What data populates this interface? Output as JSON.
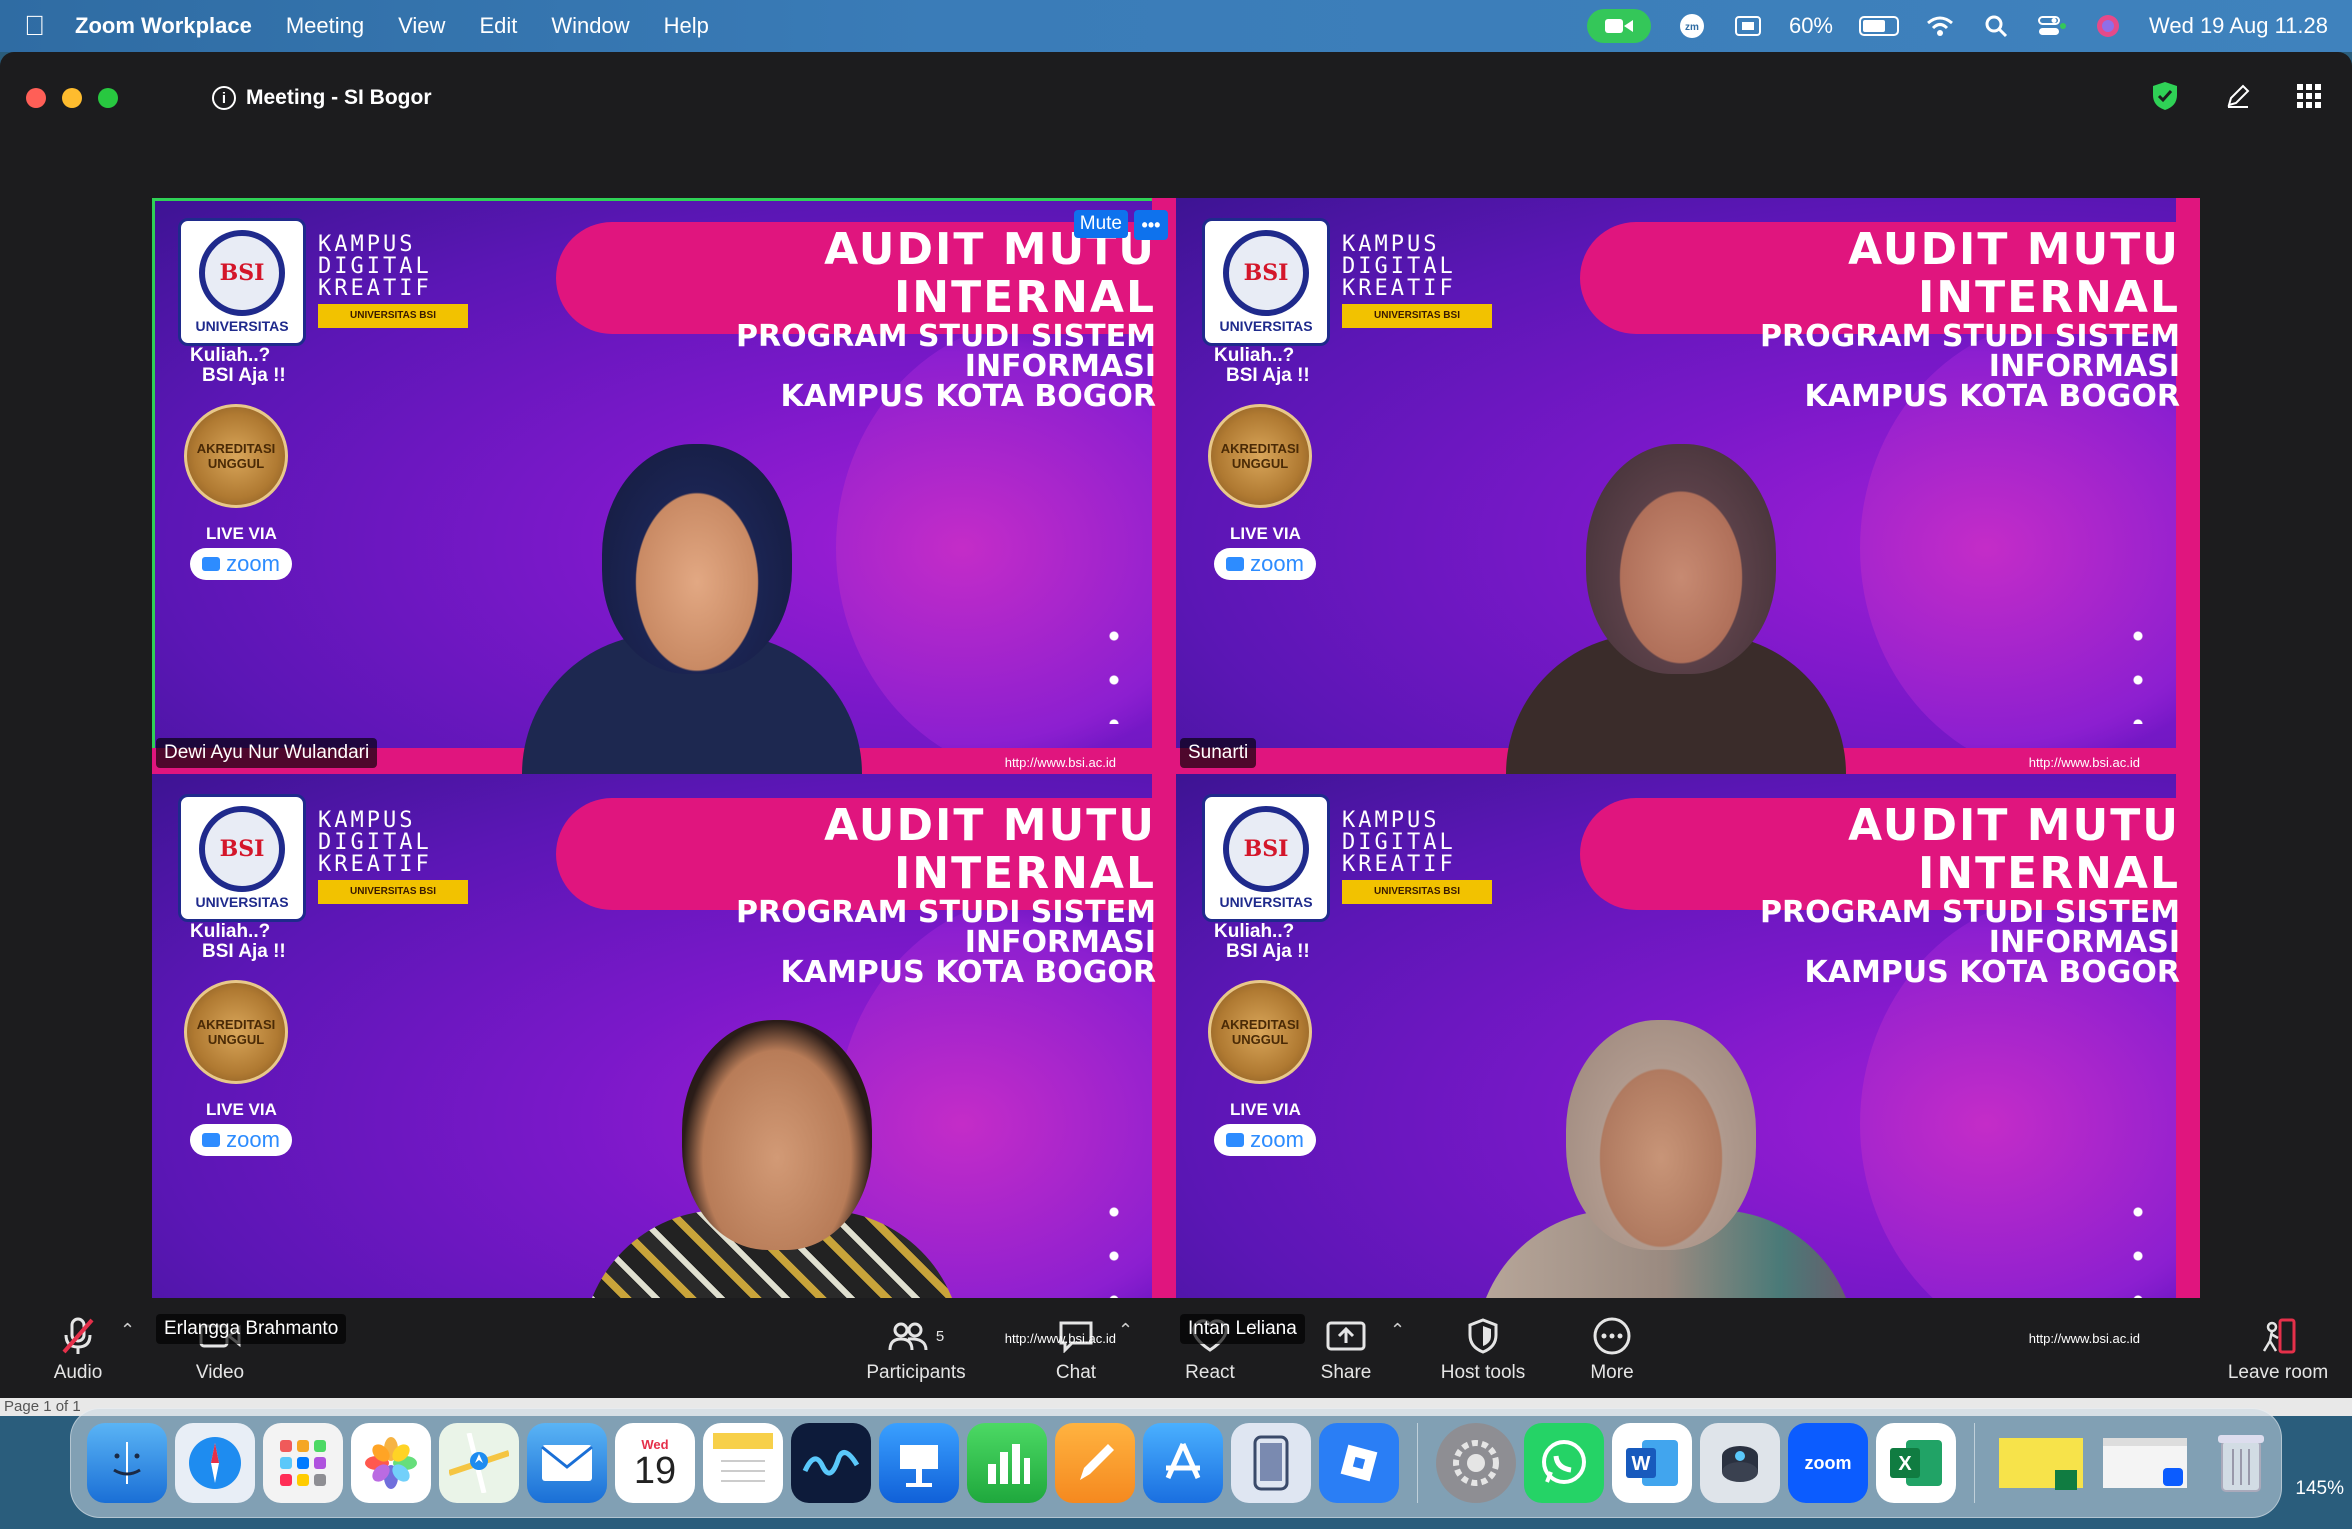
{
  "menubar": {
    "app_name": "Zoom Workplace",
    "menus": [
      "Meeting",
      "View",
      "Edit",
      "Window",
      "Help"
    ],
    "battery": "60%",
    "datetime": "Wed 19 Aug  11.28"
  },
  "window": {
    "title": "Meeting - SI Bogor"
  },
  "tile_content": {
    "kampus": [
      "KAMPUS",
      "DIGITAL",
      "KREATIF"
    ],
    "kampus_sub": "UNIVERSITAS BSI",
    "logo_caption": "UNIVERSITAS",
    "logo_mark": "BSI",
    "kuliah": [
      "Kuliah..?",
      "BSI Aja !!"
    ],
    "akreditasi": "AKREDITASI UNGGUL",
    "live_via": "LIVE VIA",
    "zoom": "zoom",
    "audit_l1": "AUDIT MUTU INTERNAL",
    "audit_l2": "PROGRAM STUDI SISTEM INFORMASI",
    "audit_l3": "KAMPUS KOTA BOGOR",
    "url": "http://www.bsi.ac.id"
  },
  "participants": [
    {
      "name": "Dewi Ayu Nur Wulandari",
      "active": true
    },
    {
      "name": "Sunarti",
      "active": false
    },
    {
      "name": "Erlangga Brahmanto",
      "active": false
    },
    {
      "name": "Intan Leliana",
      "active": false
    }
  ],
  "tile_controls": {
    "mute": "Mute",
    "more": "•••"
  },
  "toolbar": {
    "audio": "Audio",
    "video": "Video",
    "participants": "Participants",
    "participants_count": "5",
    "chat": "Chat",
    "react": "React",
    "share": "Share",
    "host_tools": "Host tools",
    "more": "More",
    "leave": "Leave room"
  },
  "docstrip": {
    "page": "Page 1 of 1"
  },
  "dock": {
    "calendar_day": "Wed",
    "calendar_date": "19",
    "zoom_label": "zoom",
    "zoom_level": "145%"
  },
  "colors": {
    "active_border": "#2fd156",
    "mute_button": "#0e72ed",
    "banner_pink": "#e0157e",
    "background_purple": "#7a18c9"
  }
}
